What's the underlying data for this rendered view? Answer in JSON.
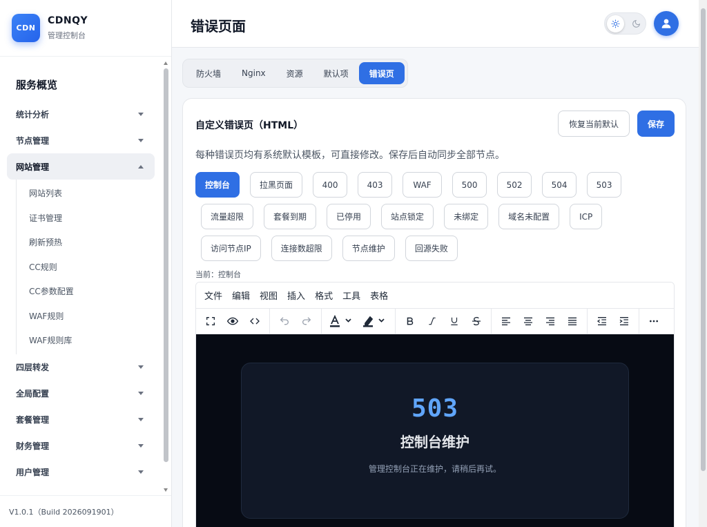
{
  "brand": {
    "logo": "CDN",
    "name": "CDNQY",
    "subtitle": "管理控制台"
  },
  "nav": {
    "heading": "服务概览",
    "groups_top": [
      {
        "label": "统计分析",
        "icon": "chevron-down-icon"
      },
      {
        "label": "节点管理",
        "icon": "chevron-down-icon"
      }
    ],
    "active_group": {
      "label": "网站管理",
      "icon": "chevron-up-icon"
    },
    "sub_items": [
      "网站列表",
      "证书管理",
      "刷新预热",
      "CC规则",
      "CC参数配置",
      "WAF规则",
      "WAF规则库"
    ],
    "groups_bottom": [
      {
        "label": "四层转发",
        "icon": "chevron-down-icon"
      },
      {
        "label": "全局配置",
        "icon": "chevron-down-icon"
      },
      {
        "label": "套餐管理",
        "icon": "chevron-down-icon"
      },
      {
        "label": "财务管理",
        "icon": "chevron-down-icon"
      },
      {
        "label": "用户管理",
        "icon": "chevron-down-icon"
      }
    ]
  },
  "version": "V1.0.1（Build 2026091901）",
  "header": {
    "title": "错误页面",
    "theme_icons": [
      "sun-icon",
      "moon-icon"
    ],
    "avatar_icon": "user-icon"
  },
  "tabs": [
    "防火墙",
    "Nginx",
    "资源",
    "默认项",
    "错误页"
  ],
  "active_tab": "错误页",
  "card": {
    "title": "自定义错误页（HTML）",
    "restore_label": "恢复当前默认",
    "save_label": "保存",
    "description": "每种错误页均有系统默认模板，可直接修改。保存后自动同步全部节点。",
    "pills_row1": [
      "控制台",
      "拉黑页面",
      "400",
      "403",
      "WAF",
      "500",
      "502",
      "504",
      "503"
    ],
    "pills_row2": [
      "流量超限",
      "套餐到期",
      "已停用",
      "站点锁定",
      "未绑定",
      "域名未配置",
      "ICP"
    ],
    "pills_row3": [
      "访问节点IP",
      "连接数超限",
      "节点维护",
      "回源失败"
    ],
    "active_pill": "控制台",
    "current_label": "当前：控制台"
  },
  "editor": {
    "menu": [
      "文件",
      "编辑",
      "视图",
      "插入",
      "格式",
      "工具",
      "表格"
    ],
    "toolbar_icons": [
      "fullscreen-icon",
      "preview-icon",
      "code-icon",
      "undo-icon",
      "redo-icon",
      "text-color-icon",
      "highlight-icon",
      "bold-icon",
      "italic-icon",
      "underline-icon",
      "strikethrough-icon",
      "align-left-icon",
      "align-center-icon",
      "align-right-icon",
      "align-justify-icon",
      "outdent-icon",
      "indent-icon",
      "more-icon"
    ],
    "preview": {
      "code": "503",
      "title": "控制台维护",
      "message": "管理控制台正在维护，请稍后再试。"
    }
  },
  "colors": {
    "accent": "#2f6fe4",
    "preview_bg": "#070b14",
    "preview_code": "#60a5fa"
  }
}
